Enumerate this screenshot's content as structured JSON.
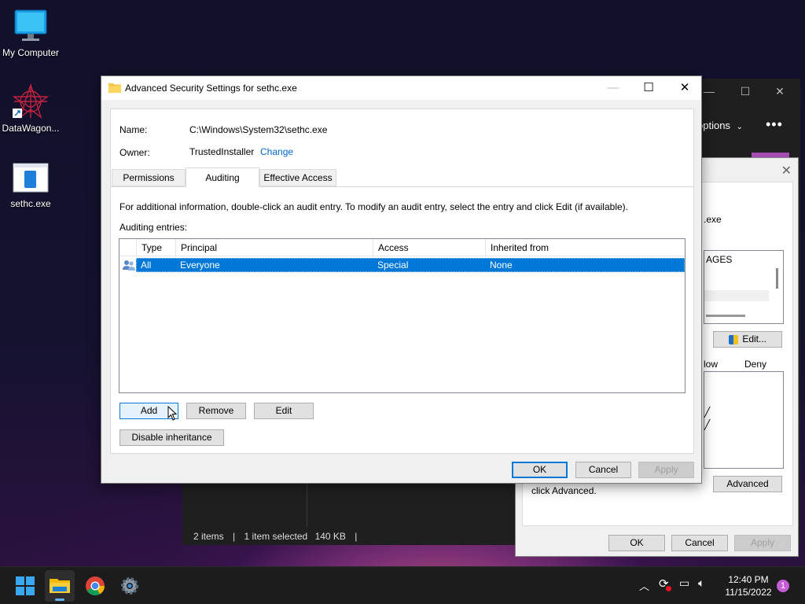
{
  "desktop": {
    "icons": [
      {
        "label": "My Computer",
        "icon": "monitor-icon"
      },
      {
        "label": "DataWagon...",
        "icon": "datawagon-icon"
      },
      {
        "label": "sethc.exe",
        "icon": "exe-file-icon"
      }
    ]
  },
  "explorer": {
    "options_label": "options",
    "status": {
      "items": "2 items",
      "selected": "1 item selected",
      "size": "140 KB"
    }
  },
  "props_dialog": {
    "file_fragment": ".exe",
    "list_fragment": "AGES",
    "edit_label": "Edit...",
    "allow_fragment": "low",
    "deny_label": "Deny",
    "hint_fragment": "click Advanced.",
    "advanced_label": "Advanced",
    "ok_label": "OK",
    "cancel_label": "Cancel",
    "apply_label": "Apply"
  },
  "dialog": {
    "title": "Advanced Security Settings for sethc.exe",
    "name_label": "Name:",
    "name_value": "C:\\Windows\\System32\\sethc.exe",
    "owner_label": "Owner:",
    "owner_value": "TrustedInstaller",
    "change_link": "Change",
    "tabs": [
      {
        "label": "Permissions",
        "active": false
      },
      {
        "label": "Auditing",
        "active": true
      },
      {
        "label": "Effective Access",
        "active": false
      }
    ],
    "info_text": "For additional information, double-click an audit entry. To modify an audit entry, select the entry and click Edit (if available).",
    "entries_label": "Auditing entries:",
    "columns": [
      "Type",
      "Principal",
      "Access",
      "Inherited from"
    ],
    "rows": [
      {
        "type": "All",
        "principal": "Everyone",
        "access": "Special",
        "inherited": "None",
        "selected": true
      }
    ],
    "add_label": "Add",
    "remove_label": "Remove",
    "edit_label": "Edit",
    "disable_inheritance_label": "Disable inheritance",
    "ok_label": "OK",
    "cancel_label": "Cancel",
    "apply_label": "Apply"
  },
  "taskbar": {
    "time": "12:40 PM",
    "date": "11/15/2022",
    "notification_count": "1"
  },
  "colors": {
    "accent": "#0078d7",
    "link": "#0066cc"
  }
}
